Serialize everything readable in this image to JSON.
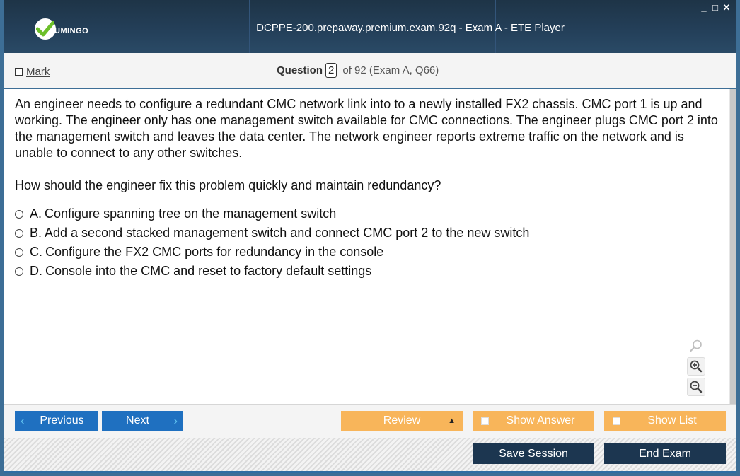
{
  "window": {
    "title": "DCPPE-200.prepaway.premium.exam.92q - Exam A - ETE Player",
    "logo_text": "UMINGO",
    "controls": {
      "minimize": "_",
      "maximize": "□",
      "close": "✕"
    }
  },
  "header": {
    "mark_label": "Mark",
    "question_label": "Question",
    "question_number": "2",
    "question_of": "of 92 (Exam A, Q66)"
  },
  "question": {
    "text": "An engineer needs to configure a redundant CMC network link into to a newly installed FX2 chassis. CMC port 1 is up and working. The engineer only has one management switch available for CMC connections. The engineer plugs CMC port 2 into the management switch and leaves the data center. The network engineer reports extreme traffic on the network and is unable to connect to any other switches.",
    "prompt": "How should the engineer fix this problem quickly and maintain redundancy?",
    "options": [
      {
        "letter": "A.",
        "text": "Configure spanning tree on the management switch"
      },
      {
        "letter": "B.",
        "text": "Add a second stacked management switch and connect CMC port 2 to the new switch"
      },
      {
        "letter": "C.",
        "text": "Configure the FX2 CMC ports for redundancy in the console"
      },
      {
        "letter": "D.",
        "text": "Console into the CMC and reset to factory default settings"
      }
    ]
  },
  "nav": {
    "previous": "Previous",
    "next": "Next",
    "review": "Review",
    "show_answer": "Show Answer",
    "show_list": "Show List",
    "save_session": "Save Session",
    "end_exam": "End Exam"
  },
  "icons": {
    "search": "search-icon",
    "zoom_in": "zoom-in-icon",
    "zoom_out": "zoom-out-icon",
    "logo": "checkmark-logo-icon"
  },
  "colors": {
    "title_bar": "#24405a",
    "nav_blue": "#1f70c0",
    "orange": "#f8b55a",
    "dark_button": "#1c3650",
    "logo_green": "#6cbf2a"
  }
}
